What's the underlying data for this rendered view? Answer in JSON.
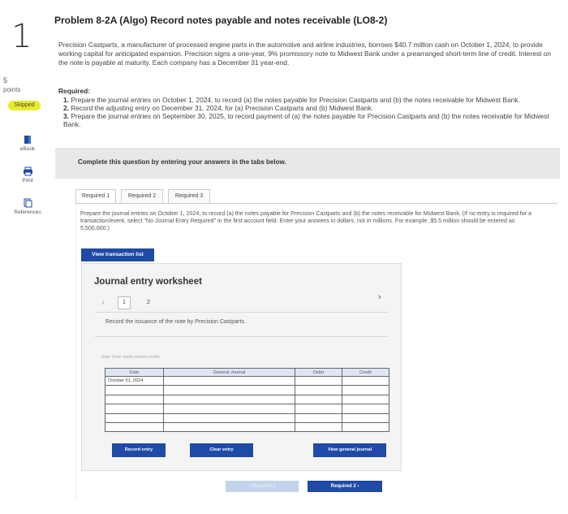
{
  "question": {
    "number": "1",
    "points_value": "5",
    "points_label": "points",
    "status_badge": "Skipped"
  },
  "rail": {
    "ebook_label": "eBook",
    "print_label": "Print",
    "references_label": "References"
  },
  "problem": {
    "title": "Problem 8-2A (Algo) Record notes payable and notes receivable (LO8-2)",
    "intro": "Precision Castparts, a manufacturer of processed engine parts in the automotive and airline industries, borrows $40.7 million cash on October 1, 2024, to provide working capital for anticipated expansion. Precision signs a one-year, 9% promissory note to Midwest Bank under a prearranged short-term line of credit. Interest on the note is payable at maturity. Each company has a December 31 year-end.",
    "required_heading": "Required:",
    "required": [
      {
        "num": "1.",
        "text": "Prepare the journal entries on October 1, 2024, to record (a) the notes payable for Precision Castparts and (b) the notes receivable for Midwest Bank."
      },
      {
        "num": "2.",
        "text": "Record the adjusting entry on December 31, 2024, for (a) Precision Castparts and (b) Midwest Bank."
      },
      {
        "num": "3.",
        "text": "Prepare the journal entries on September 30, 2025, to record payment of (a) the notes payable for Precision Castparts and (b) the notes receivable for Midwest Bank."
      }
    ]
  },
  "instruction": "Complete this question by entering your answers in the tabs below.",
  "tabs": [
    "Required 1",
    "Required 2",
    "Required 3"
  ],
  "tab_instructions": "Prepare the journal entries on October 1, 2024, to record (a) the notes payable for Precision Castparts and (b) the notes receivable for Midwest Bank. (If no entry is required for a transaction/event, select \"No Journal Entry Required\" in the first account field. Enter your answers in dollars, not in millions. For example, $5.5 million should be entered as 5,500,000.)",
  "view_transaction_list_label": "View transaction list",
  "worksheet": {
    "title": "Journal entry worksheet",
    "pages": [
      "1",
      "2"
    ],
    "description": "Record the issuance of the note by Precision Castparts.",
    "note": "Note: Enter debits before credits.",
    "columns": [
      "Date",
      "General Journal",
      "Debit",
      "Credit"
    ],
    "rows": [
      {
        "date": "October 01, 2024",
        "account": "",
        "debit": "",
        "credit": ""
      },
      {
        "date": "",
        "account": "",
        "debit": "",
        "credit": ""
      },
      {
        "date": "",
        "account": "",
        "debit": "",
        "credit": ""
      },
      {
        "date": "",
        "account": "",
        "debit": "",
        "credit": ""
      },
      {
        "date": "",
        "account": "",
        "debit": "",
        "credit": ""
      },
      {
        "date": "",
        "account": "",
        "debit": "",
        "credit": ""
      }
    ],
    "record_entry_label": "Record entry",
    "clear_entry_label": "Clear entry",
    "view_general_journal_label": "View general journal"
  },
  "nav": {
    "back_label": "Required 1",
    "next_label": "Required 2"
  },
  "colors": {
    "primary_button": "#1f4aa6",
    "skipped_badge": "#e9eb2c",
    "band": "#e8e8e8"
  }
}
